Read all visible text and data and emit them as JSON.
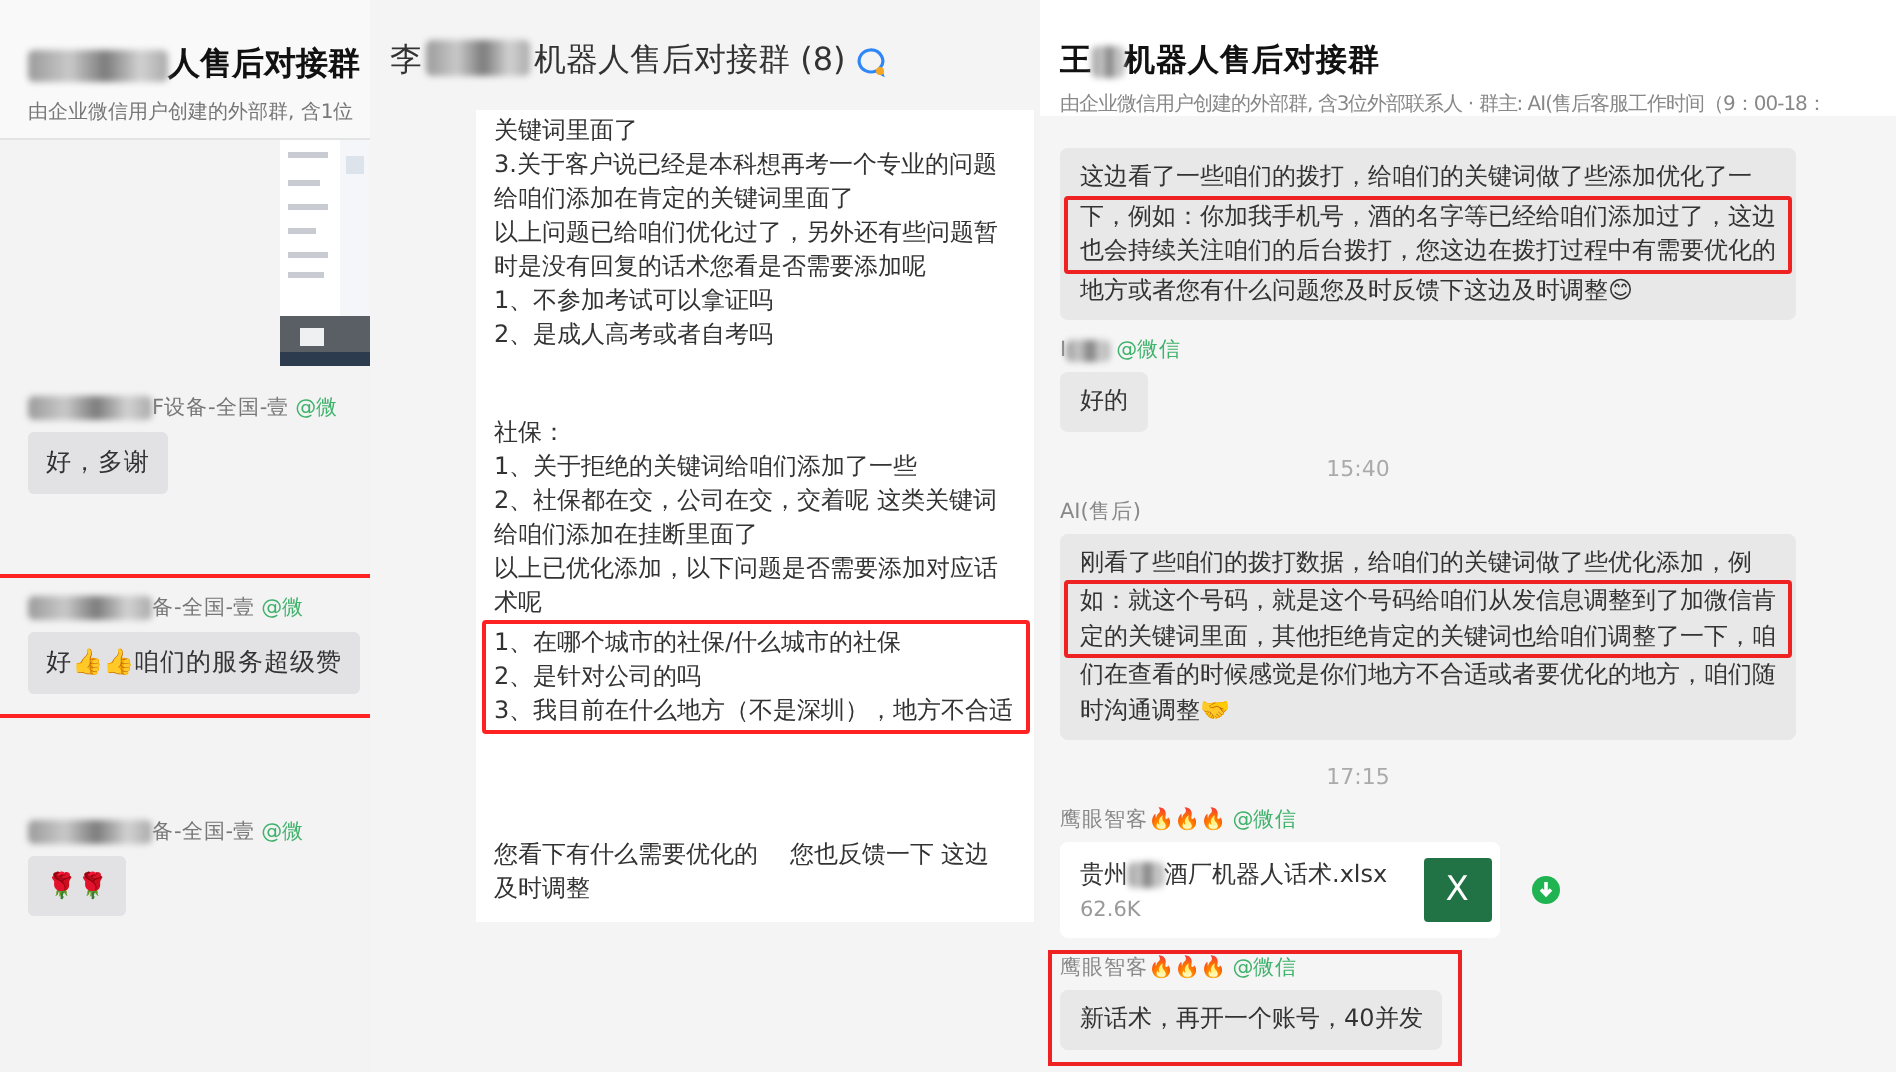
{
  "left_panel": {
    "title": "人售后对接群",
    "subtitle": "由企业微信用户创建的外部群, 含1位",
    "messages": [
      {
        "sender": "F设备-全国-壹",
        "source": "@微",
        "text": "好，多谢",
        "highlighted": false
      },
      {
        "sender": "备-全国-壹",
        "source": "@微",
        "text": "好👍👍咱们的服务超级赞",
        "highlighted": true
      },
      {
        "sender": "备-全国-壹",
        "source": "@微",
        "text": "🌹🌹",
        "highlighted": false
      }
    ]
  },
  "middle_panel": {
    "title_start": "李",
    "title_end": "机器人售后对接群 (8)",
    "blocks": [
      {
        "highlighted": false,
        "lines": [
          "关键词里面了",
          "3.关于客户说已经是本科想再考一个专业的问题",
          "给咱们添加在肯定的关键词里面了",
          "以上问题已给咱们优化过了，另外还有些问题暂",
          "时是没有回复的话术您看是否需要添加呢",
          "1、不参加考试可以拿证吗",
          "2、是成人高考或者自考吗"
        ]
      },
      {
        "highlighted": false,
        "lines": [
          "社保：",
          "1、关于拒绝的关键词给咱们添加了一些",
          "2、社保都在交，公司在交，交着呢 这类关键词",
          "给咱们添加在挂断里面了",
          "以上已优化添加，以下问题是否需要添加对应话",
          "术呢"
        ]
      },
      {
        "highlighted": true,
        "lines": [
          "1、在哪个城市的社保/什么城市的社保",
          "2、是针对公司的吗",
          "3、我目前在什么地方（不是深圳），地方不合适"
        ]
      },
      {
        "highlighted": false,
        "lines": [
          "您看下有什么需要优化的　 您也反馈一下  这边",
          "及时调整"
        ]
      }
    ]
  },
  "right_panel": {
    "title_start": "王",
    "title_end": "机器人售后对接群",
    "subtitle": "由企业微信用户创建的外部群, 含3位外部联系人 · 群主: AI(售后客服工作时间（9：00-18：",
    "messages": [
      {
        "kind": "text",
        "segments": [
          {
            "highlighted": false,
            "lines": [
              "这边看了一些咱们的拨打，给咱们的关键词做了些添加优化了一"
            ]
          },
          {
            "highlighted": true,
            "lines": [
              "下，例如：你加我手机号，酒的名字等已经给咱们添加过了，这边",
              "也会持续关注咱们的后台拨打，您这边在拨打过程中有需要优化的"
            ]
          },
          {
            "highlighted": false,
            "lines": [
              "地方或者您有什么问题您及时反馈下这边及时调整😊"
            ]
          }
        ]
      },
      {
        "kind": "text",
        "sender": "I",
        "redacted": true,
        "source": "@微信",
        "segments": [
          {
            "highlighted": false,
            "lines": [
              "好的"
            ]
          }
        ]
      },
      {
        "kind": "time",
        "time": "15:40"
      },
      {
        "kind": "text",
        "sender": "AI(售后)",
        "redacted": false,
        "segments": [
          {
            "highlighted": false,
            "lines": [
              "刚看了些咱们的拨打数据，给咱们的关键词做了些优化添加，例"
            ]
          },
          {
            "highlighted": true,
            "lines": [
              "如：就这个号码，就是这个号码给咱们从发信息调整到了加微信肯",
              "定的关键词里面，其他拒绝肯定的关键词也给咱们调整了一下，咱"
            ]
          },
          {
            "highlighted": false,
            "lines": [
              "们在查看的时候感觉是你们地方不合适或者要优化的地方，咱们随",
              "时沟通调整🤝"
            ]
          }
        ]
      },
      {
        "kind": "time",
        "time": "17:15"
      },
      {
        "kind": "file",
        "sender": "鹰眼智客🔥🔥🔥",
        "redacted": false,
        "source": "@微信",
        "name_start": "贵州",
        "name_end": "酒厂机器人话术.xlsx",
        "size": "62.6K",
        "badge": "X"
      },
      {
        "kind": "text",
        "sender": "鹰眼智客🔥🔥🔥",
        "redacted": false,
        "source": "@微信",
        "highlighted": true,
        "segments": [
          {
            "highlighted": false,
            "lines": [
              "新话术，再开一个账号，40并发"
            ]
          }
        ]
      }
    ]
  }
}
